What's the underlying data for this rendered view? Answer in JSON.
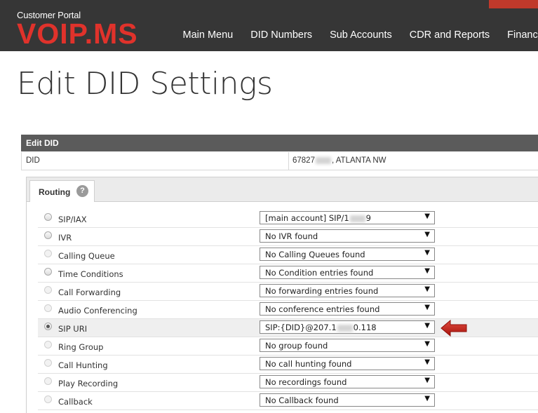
{
  "header": {
    "portal_label": "Customer Portal",
    "logo_text": "VOIP.MS",
    "brand_color": "#e0322b",
    "nav": [
      "Main Menu",
      "DID Numbers",
      "Sub Accounts",
      "CDR and Reports",
      "Finances"
    ]
  },
  "page": {
    "title": "Edit DID Settings"
  },
  "panel": {
    "title": "Edit DID",
    "did_label": "DID",
    "did_value_prefix": "67827",
    "did_value_suffix": ", ATLANTA NW"
  },
  "tabs": {
    "routing_label": "Routing",
    "help_glyph": "?"
  },
  "routing_options": [
    {
      "label": "SIP/IAX",
      "value_prefix": "[main account] SIP/1",
      "value_suffix": "9",
      "blurred": true,
      "checked": false,
      "disabled": false
    },
    {
      "label": "IVR",
      "value": "No IVR found",
      "checked": false,
      "disabled": false
    },
    {
      "label": "Calling Queue",
      "value": "No Calling Queues found",
      "checked": false,
      "disabled": true
    },
    {
      "label": "Time Conditions",
      "value": "No Condition entries found",
      "checked": false,
      "disabled": false
    },
    {
      "label": "Call Forwarding",
      "value": "No forwarding entries found",
      "checked": false,
      "disabled": true
    },
    {
      "label": "Audio Conferencing",
      "value": "No conference entries found",
      "checked": false,
      "disabled": true
    },
    {
      "label": "SIP URI",
      "value_prefix": "SIP:{DID}@207.1",
      "value_suffix": "0.118",
      "blurred": true,
      "checked": true,
      "disabled": false
    },
    {
      "label": "Ring Group",
      "value": "No group found",
      "checked": false,
      "disabled": true
    },
    {
      "label": "Call Hunting",
      "value": "No call hunting found",
      "checked": false,
      "disabled": true
    },
    {
      "label": "Play Recording",
      "value": "No recordings found",
      "checked": false,
      "disabled": true
    },
    {
      "label": "Callback",
      "value": "No Callback found",
      "checked": false,
      "disabled": true
    }
  ],
  "icons": {
    "select_arrow": "▼",
    "pointer_arrow": "red-left-arrow-icon"
  }
}
